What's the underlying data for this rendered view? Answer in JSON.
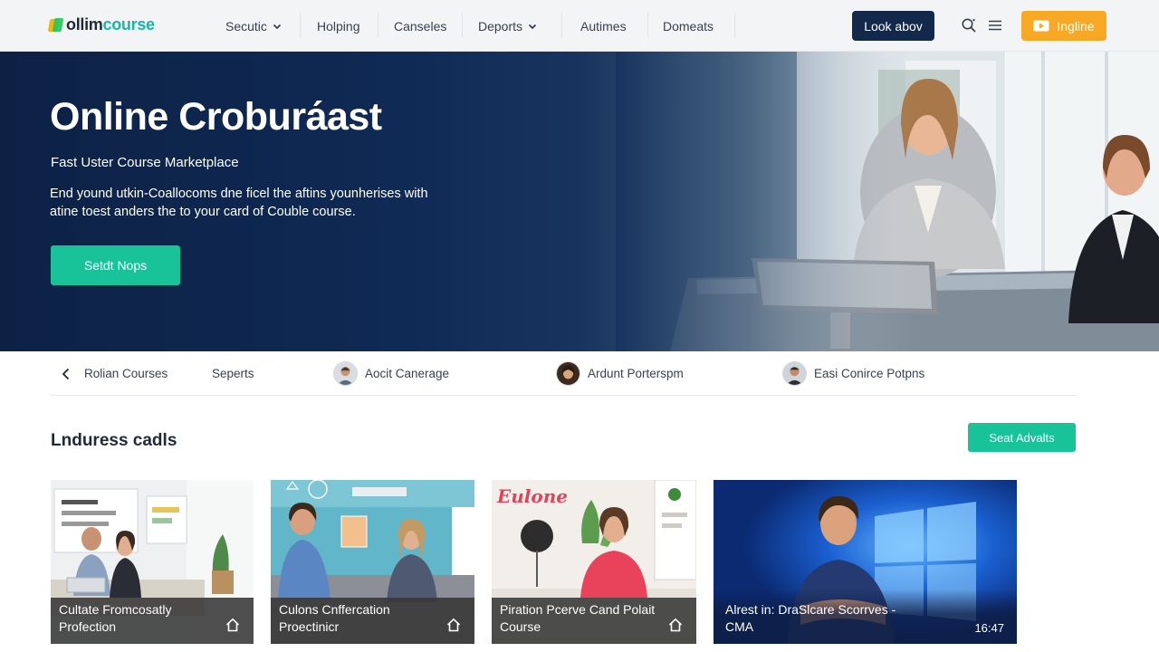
{
  "brand": {
    "part1": "ollim",
    "part2": "course"
  },
  "nav": {
    "items": [
      {
        "label": "Secutic",
        "has_dropdown": true
      },
      {
        "label": "Holping",
        "has_dropdown": false
      },
      {
        "label": "Canseles",
        "has_dropdown": false
      },
      {
        "label": "Deports",
        "has_dropdown": true
      },
      {
        "label": "Autimes",
        "has_dropdown": false
      },
      {
        "label": "Domeats",
        "has_dropdown": false
      }
    ],
    "look_button": "Look abov",
    "language_button": "Ingline",
    "icons": [
      "search-icon",
      "menu-icon",
      "play-icon"
    ]
  },
  "hero": {
    "title": "Online Croburа́ast",
    "subtitle": "Fast Uster Course Marketplace",
    "description": "End yound utkin-Coallocoms dne ficel the aftins younherises with atine toest anders the to your card of Couble course.",
    "cta": "Setdt Nops"
  },
  "categories": [
    {
      "label": "Rolian Courses",
      "icon": "chevron-left-icon"
    },
    {
      "label": "Seperts"
    },
    {
      "label": "Aocit Canerage",
      "icon": "avatar"
    },
    {
      "label": "Ardunt Porterspm",
      "icon": "avatar"
    },
    {
      "label": "Easi Conirce Potpns",
      "icon": "avatar"
    }
  ],
  "section": {
    "title": "Lnduress cadls",
    "see_all": "Seat Advalts"
  },
  "courses": [
    {
      "title": "Cultate Fromcosatly Profection",
      "icon": "home-icon"
    },
    {
      "title": "Culons Cnffercation Proectinicr",
      "icon": "home-icon"
    },
    {
      "title": "Piration Pcerve Cand Polait Course",
      "icon": "home-icon",
      "badge": "Eulone"
    },
    {
      "title": "Alrest in: DraSlcare Scorrves - CMA",
      "duration": "16:47"
    }
  ],
  "colors": {
    "navy": "#13294b",
    "teal": "#18c39a",
    "orange": "#f7a925",
    "hero_bg": "#0d2145"
  }
}
